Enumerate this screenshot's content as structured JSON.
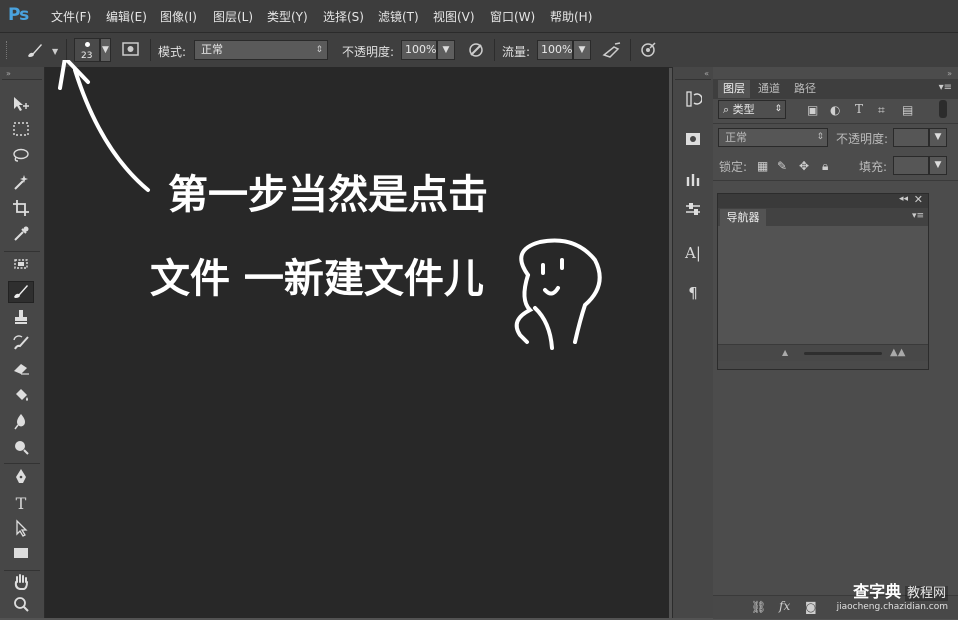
{
  "app": {
    "logo": "Ps"
  },
  "menu": {
    "items": [
      "文件(F)",
      "编辑(E)",
      "图像(I)",
      "图层(L)",
      "类型(Y)",
      "选择(S)",
      "滤镜(T)",
      "视图(V)",
      "窗口(W)",
      "帮助(H)"
    ]
  },
  "options": {
    "brush_size": "23",
    "mode_label": "模式:",
    "mode_value": "正常",
    "opacity_label": "不透明度:",
    "opacity_value": "100%",
    "flow_label": "流量:",
    "flow_value": "100%"
  },
  "tools": [
    "move-tool",
    "marquee-tool",
    "lasso-tool",
    "magic-wand-tool",
    "crop-tool",
    "eyedropper-tool",
    "healing-tool",
    "brush-tool",
    "stamp-tool",
    "history-brush-tool",
    "eraser-tool",
    "paint-bucket-tool",
    "blur-tool",
    "dodge-tool",
    "pen-tool",
    "type-tool",
    "path-select-tool",
    "shape-tool",
    "hand-tool",
    "zoom-tool"
  ],
  "layers_panel": {
    "tabs": [
      "图层",
      "通道",
      "路径"
    ],
    "filter_label": "类型",
    "blend_mode": "正常",
    "opacity_label": "不透明度:",
    "lock_label": "锁定:",
    "fill_label": "填充:"
  },
  "navigator_panel": {
    "tab": "导航器"
  },
  "annotation": {
    "line1": "第一步当然是点击",
    "line2": "文件 一新建文件儿"
  },
  "watermark": {
    "title": "查字典",
    "subtitle": "教程网",
    "url": "jiaocheng.chazidian.com"
  },
  "colors": {
    "accent": "#4aa3df",
    "canvas": "#282828",
    "panel": "#535353"
  }
}
